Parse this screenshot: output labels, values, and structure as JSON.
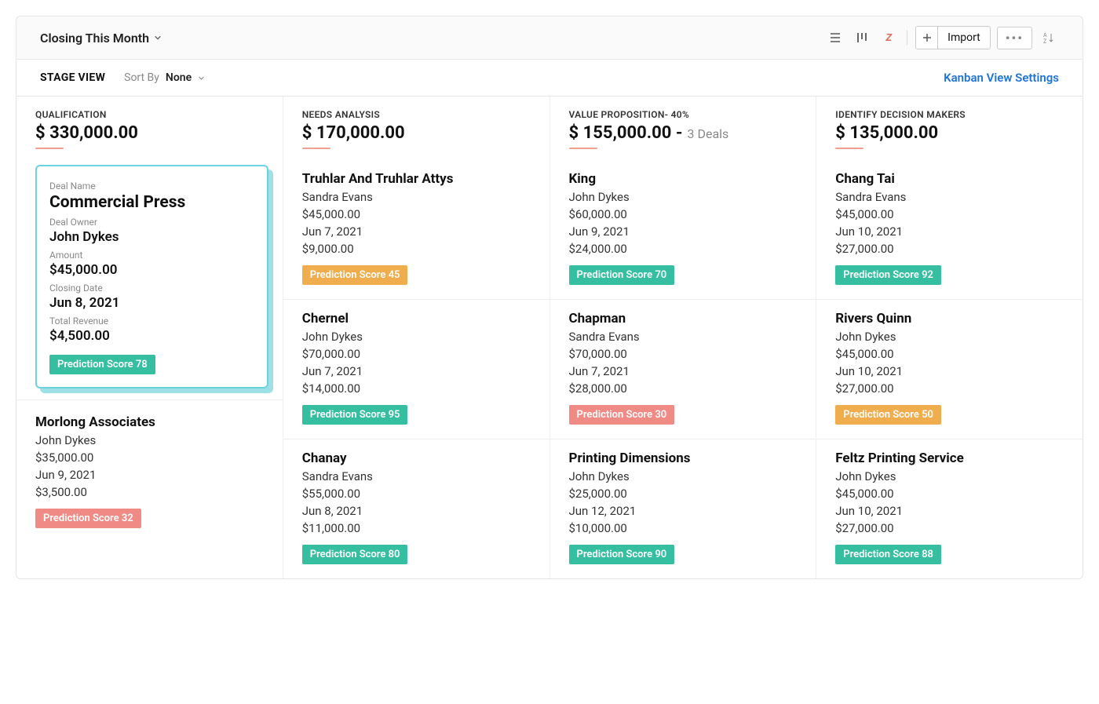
{
  "topbar": {
    "filter_label": "Closing This Month",
    "import_label": "Import"
  },
  "subbar": {
    "stage_view_label": "STAGE VIEW",
    "sort_by_label": "Sort By",
    "sort_by_value": "None",
    "kanban_link": "Kanban View Settings"
  },
  "columns": [
    {
      "title": "QUALIFICATION",
      "amount": "$ 330,000.00",
      "subtext": "",
      "spotlight": {
        "deal_name_label": "Deal Name",
        "deal_name": "Commercial Press",
        "owner_label": "Deal Owner",
        "owner": "John Dykes",
        "amount_label": "Amount",
        "amount": "$45,000.00",
        "closing_label": "Closing Date",
        "closing": "Jun 8, 2021",
        "revenue_label": "Total Revenue",
        "revenue": "$4,500.00",
        "score_text": "Prediction Score 78",
        "score_class": "score-green"
      },
      "cards": [
        {
          "title": "Morlong Associates",
          "owner": "John Dykes",
          "amount": "$35,000.00",
          "date": "Jun 9, 2021",
          "revenue": "$3,500.00",
          "score_text": "Prediction Score 32",
          "score_class": "score-red"
        }
      ]
    },
    {
      "title": "NEEDS ANALYSIS",
      "amount": "$ 170,000.00",
      "subtext": "",
      "cards": [
        {
          "title": "Truhlar And Truhlar Attys",
          "owner": "Sandra Evans",
          "amount": "$45,000.00",
          "date": "Jun 7, 2021",
          "revenue": "$9,000.00",
          "score_text": "Prediction Score 45",
          "score_class": "score-amber"
        },
        {
          "title": "Chernel",
          "owner": "John Dykes",
          "amount": "$70,000.00",
          "date": "Jun 7, 2021",
          "revenue": "$14,000.00",
          "score_text": "Prediction Score 95",
          "score_class": "score-green"
        },
        {
          "title": "Chanay",
          "owner": "Sandra Evans",
          "amount": "$55,000.00",
          "date": "Jun 8, 2021",
          "revenue": "$11,000.00",
          "score_text": "Prediction Score 80",
          "score_class": "score-green"
        }
      ]
    },
    {
      "title": "VALUE PROPOSITION- 40%",
      "amount": "$ 155,000.00 -",
      "subtext": "3 Deals",
      "cards": [
        {
          "title": "King",
          "owner": "John Dykes",
          "amount": "$60,000.00",
          "date": "Jun 9, 2021",
          "revenue": "$24,000.00",
          "score_text": "Prediction Score 70",
          "score_class": "score-green"
        },
        {
          "title": "Chapman",
          "owner": "Sandra Evans",
          "amount": "$70,000.00",
          "date": "Jun 7, 2021",
          "revenue": "$28,000.00",
          "score_text": "Prediction Score 30",
          "score_class": "score-red"
        },
        {
          "title": "Printing Dimensions",
          "owner": "John Dykes",
          "amount": "$25,000.00",
          "date": "Jun 12, 2021",
          "revenue": "$10,000.00",
          "score_text": "Prediction Score 90",
          "score_class": "score-green"
        }
      ]
    },
    {
      "title": "IDENTIFY DECISION MAKERS",
      "amount": "$ 135,000.00",
      "subtext": "",
      "cards": [
        {
          "title": "Chang Tai",
          "owner": "Sandra Evans",
          "amount": "$45,000.00",
          "date": "Jun 10, 2021",
          "revenue": "$27,000.00",
          "score_text": "Prediction Score 92",
          "score_class": "score-green"
        },
        {
          "title": "Rivers Quinn",
          "owner": "John Dykes",
          "amount": "$45,000.00",
          "date": "Jun 10, 2021",
          "revenue": "$27,000.00",
          "score_text": "Prediction Score 50",
          "score_class": "score-amber"
        },
        {
          "title": "Feltz Printing Service",
          "owner": "John Dykes",
          "amount": "$45,000.00",
          "date": "Jun 10, 2021",
          "revenue": "$27,000.00",
          "score_text": "Prediction Score 88",
          "score_class": "score-green"
        }
      ]
    }
  ]
}
